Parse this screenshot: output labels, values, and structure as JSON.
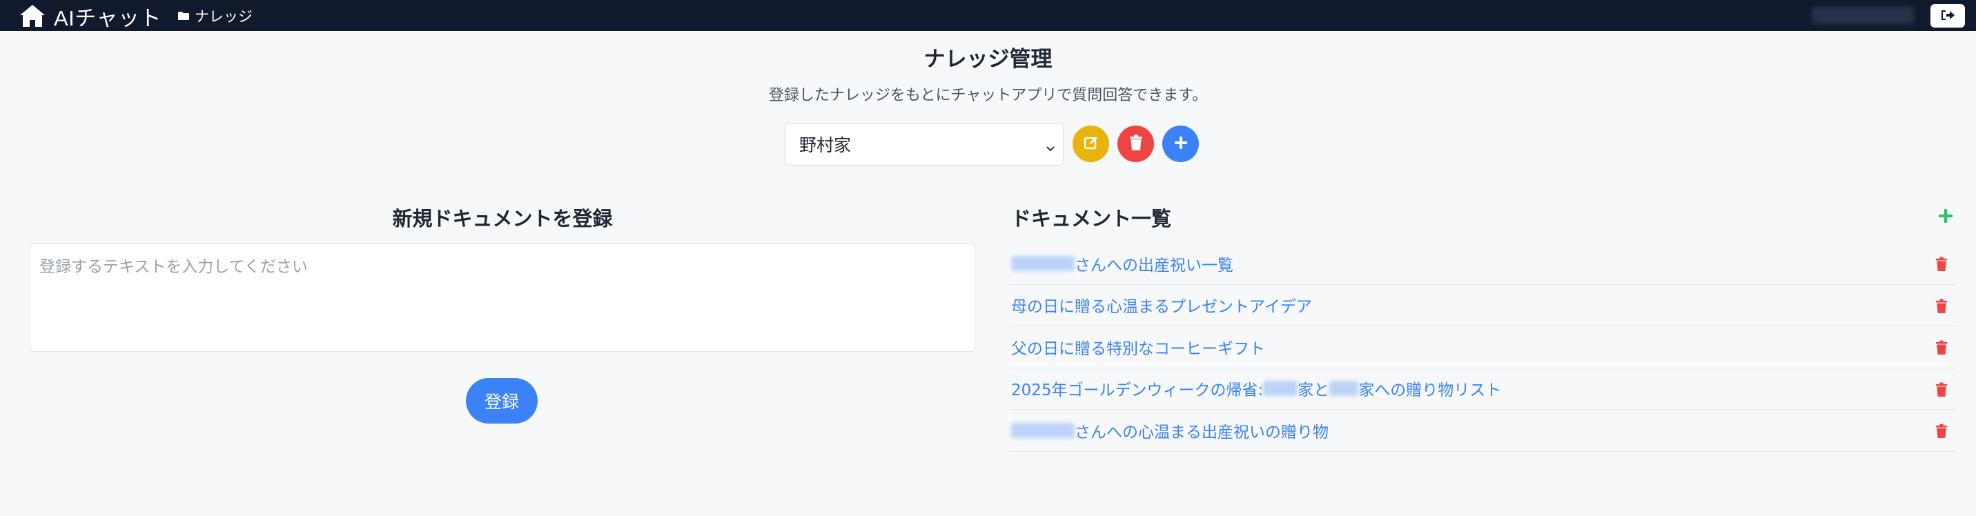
{
  "app": {
    "title": "AIチャット"
  },
  "breadcrumb": {
    "label": "ナレッジ"
  },
  "header": {
    "title": "ナレッジ管理",
    "subtitle": "登録したナレッジをもとにチャットアプリで質問回答できます。"
  },
  "knowledge_select": {
    "selected": "野村家"
  },
  "new_doc": {
    "title": "新規ドキュメントを登録",
    "placeholder": "登録するテキストを入力してください",
    "submit_label": "登録"
  },
  "doc_list": {
    "title": "ドキュメント一覧",
    "items": [
      {
        "prefix": "",
        "text": "さんへの出産祝い一覧",
        "redacted": true
      },
      {
        "prefix": "",
        "text": "母の日に贈る心温まるプレゼントアイデア",
        "redacted": false
      },
      {
        "prefix": "",
        "text": "父の日に贈る特別なコーヒーギフト",
        "redacted": false
      },
      {
        "prefix": "2025年ゴールデンウィークの帰省: ",
        "text": "家と",
        "suffix": "家への贈り物リスト",
        "redacted": true
      },
      {
        "prefix": "",
        "text": "さんへの心温まる出産祝いの贈り物",
        "redacted": true
      }
    ]
  },
  "colors": {
    "topbar": "#111a2c",
    "accent": "#3b82f6",
    "edit": "#eab30c",
    "delete": "#ef4444",
    "add_green": "#22c55e"
  },
  "icons": {
    "brand": "home-icon",
    "breadcrumb": "folder-icon",
    "logout": "logout-icon",
    "edit": "edit-icon",
    "delete": "trash-icon",
    "add": "plus-icon"
  }
}
